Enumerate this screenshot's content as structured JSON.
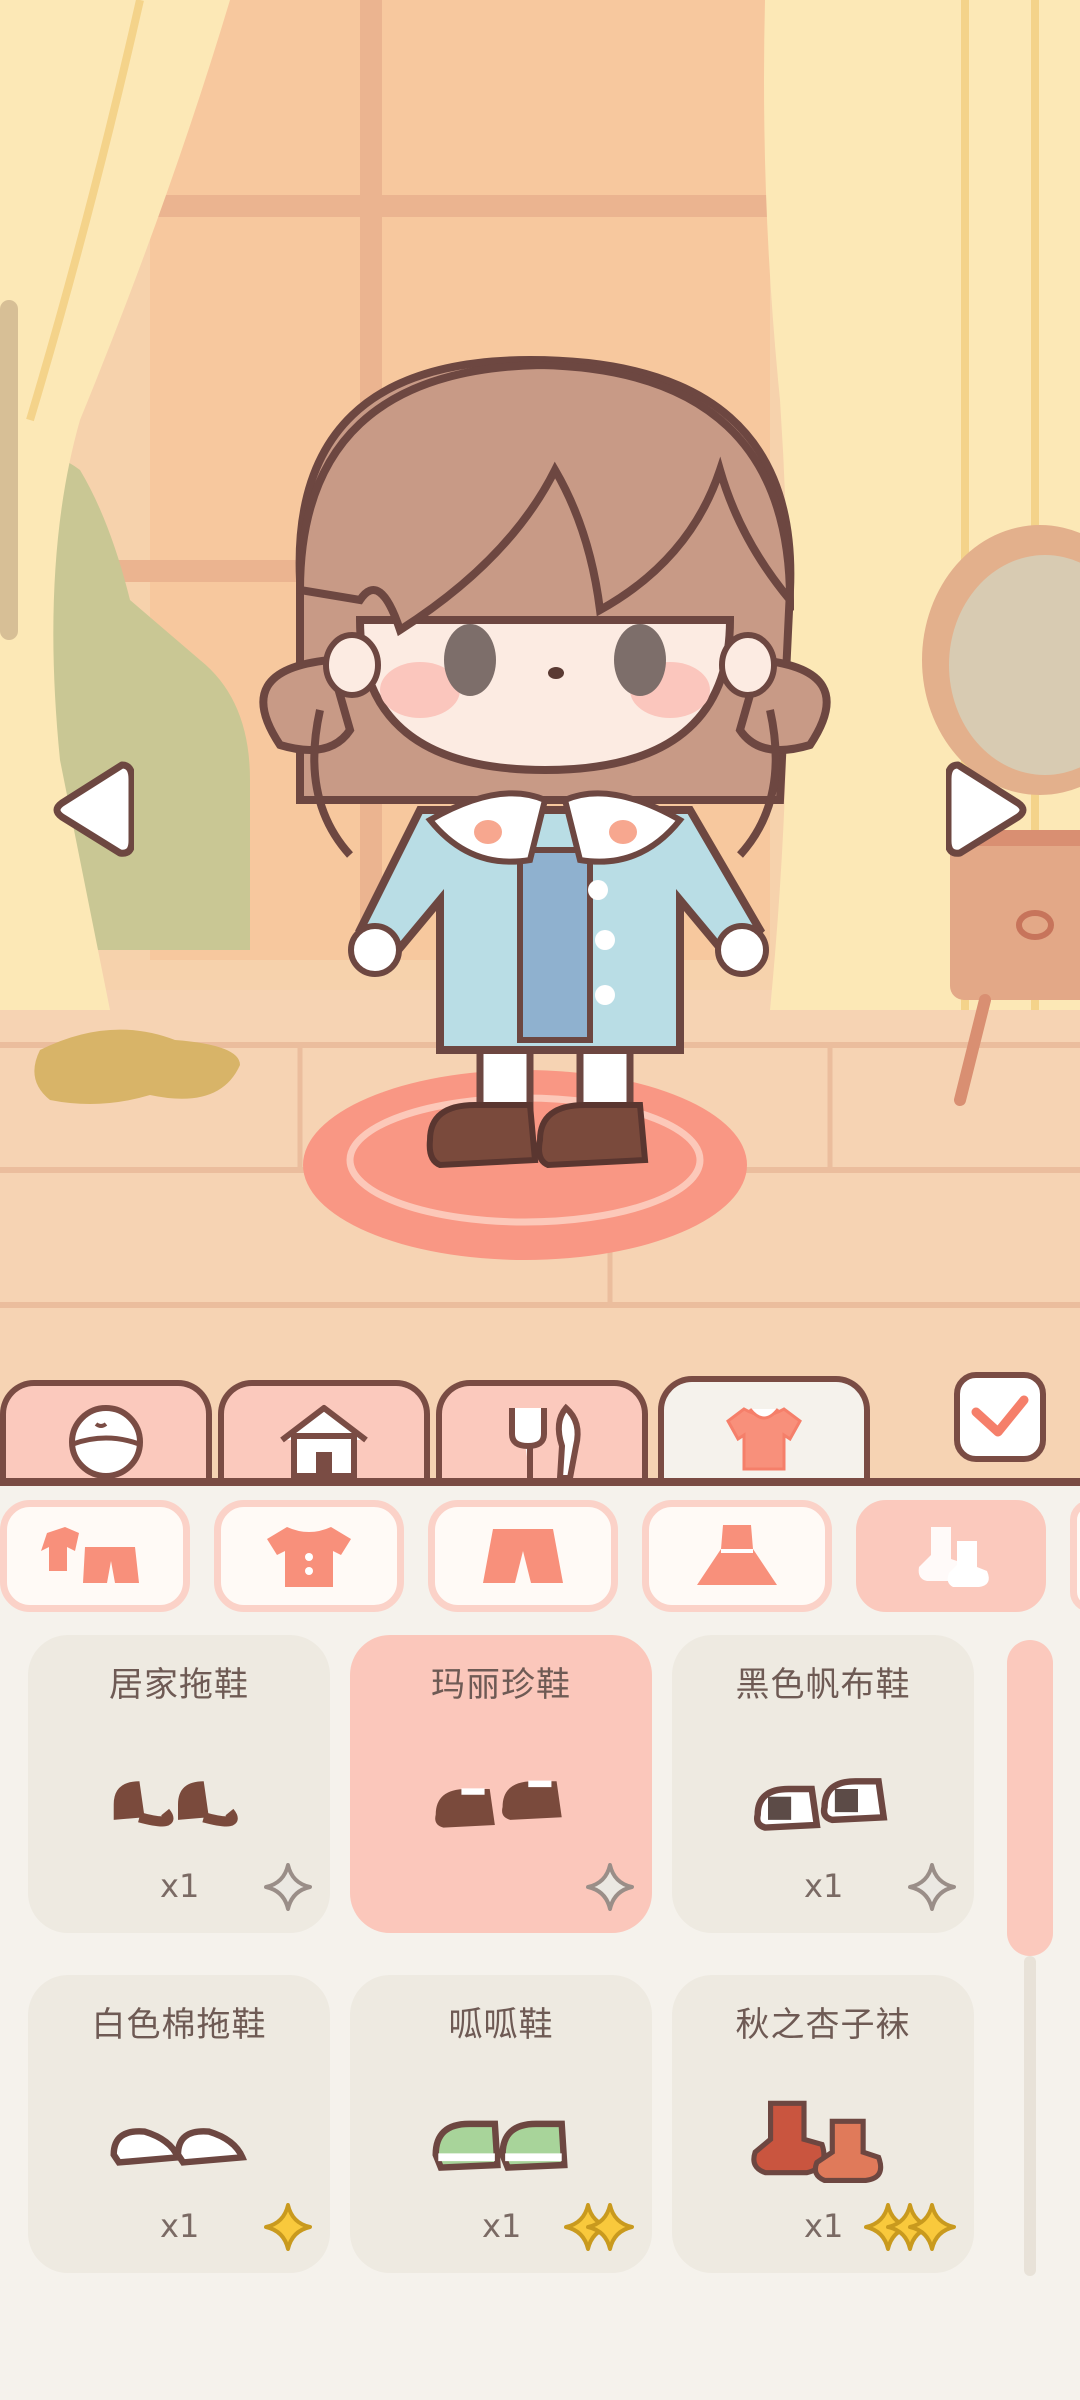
{
  "tabs": [
    {
      "icon": "face-icon"
    },
    {
      "icon": "house-icon"
    },
    {
      "icon": "fork-spoon-icon"
    },
    {
      "icon": "shirt-icon",
      "active": true
    }
  ],
  "subtabs": [
    {
      "icon": "outfit-set-icon"
    },
    {
      "icon": "top-icon"
    },
    {
      "icon": "shorts-icon"
    },
    {
      "icon": "dress-icon"
    },
    {
      "icon": "socks-icon",
      "active": true
    }
  ],
  "items": [
    {
      "name": "居家拖鞋",
      "qty": "x1",
      "rarity": 1,
      "selected": false
    },
    {
      "name": "玛丽珍鞋",
      "qty": "",
      "rarity": 1,
      "selected": true
    },
    {
      "name": "黑色帆布鞋",
      "qty": "x1",
      "rarity": 1,
      "selected": false
    },
    {
      "name": "白色棉拖鞋",
      "qty": "x1",
      "rarity": 1,
      "selected": false
    },
    {
      "name": "呱呱鞋",
      "qty": "x1",
      "rarity": 2,
      "selected": false
    },
    {
      "name": "秋之杏子袜",
      "qty": "x1",
      "rarity": 3,
      "selected": false
    }
  ],
  "colors": {
    "accent": "#f57f6a",
    "outline": "#7a4c44",
    "tab": "#fbc9bd",
    "panel": "#f5f2ec"
  }
}
